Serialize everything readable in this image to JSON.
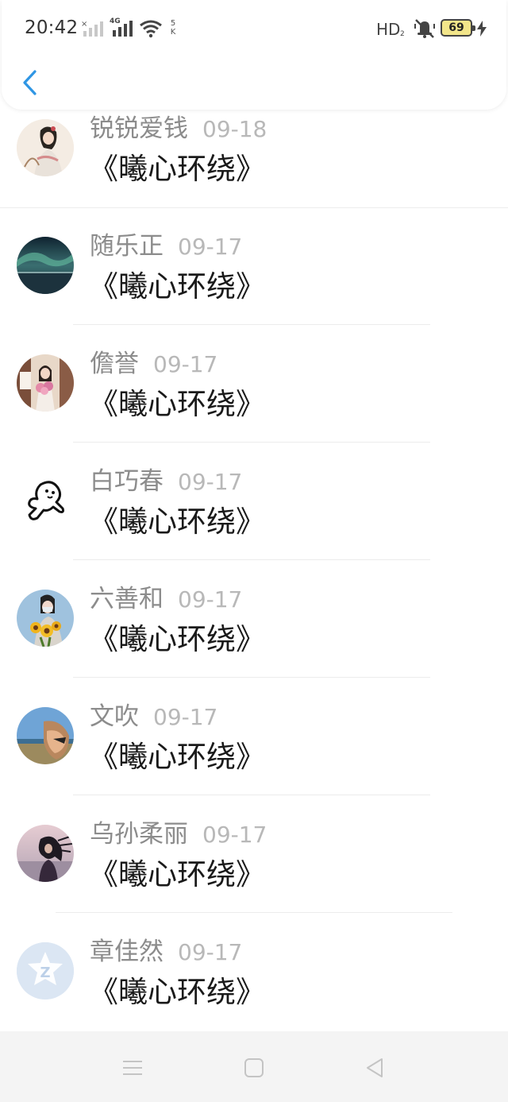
{
  "status_bar": {
    "time": "20:42",
    "net_4g": "4G",
    "speed_top": "5",
    "speed_bottom": "K",
    "hd_label": "HD",
    "battery": "69",
    "icons": [
      "signal-off-icon",
      "signal-4g-icon",
      "wifi-icon",
      "mute-icon",
      "battery-icon",
      "charging-icon"
    ]
  },
  "header": {
    "back_icon": "chevron-left-icon",
    "accent_color": "#2f96e4"
  },
  "items": [
    {
      "name": "锐锐爱钱",
      "date": "09-18",
      "message": "《曦心环绕》",
      "avatar": "avatar-ancient-costume"
    },
    {
      "name": "随乐正",
      "date": "09-17",
      "message": "《曦心环绕》",
      "avatar": "avatar-aurora"
    },
    {
      "name": "儋誉",
      "date": "09-17",
      "message": "《曦心环绕》",
      "avatar": "avatar-girl-flowers"
    },
    {
      "name": "白巧春",
      "date": "09-17",
      "message": "《曦心环绕》",
      "avatar": "avatar-cartoon-doodle"
    },
    {
      "name": "六善和",
      "date": "09-17",
      "message": "《曦心环绕》",
      "avatar": "avatar-sunflowers"
    },
    {
      "name": "文吹",
      "date": "09-17",
      "message": "《曦心环绕》",
      "avatar": "avatar-seaside-selfie"
    },
    {
      "name": "乌孙柔丽",
      "date": "09-17",
      "message": "《曦心环绕》",
      "avatar": "avatar-windy-hair"
    },
    {
      "name": "章佳然",
      "date": "09-17",
      "message": "《曦心环绕》",
      "avatar": "avatar-default-star"
    }
  ],
  "nav": {
    "icons": [
      "menu-icon",
      "home-square-icon",
      "back-triangle-icon"
    ]
  }
}
